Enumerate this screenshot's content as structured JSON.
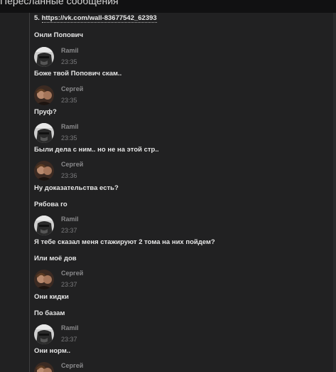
{
  "window": {
    "title": "Пересланные сообщения"
  },
  "messages": {
    "link_line": {
      "prefix": "5. ",
      "url": "https://vk.com/wall-83677542_62393"
    },
    "t1": "Онли Попович",
    "t2": "Боже твой Попович скам..",
    "t3": "Пруф?",
    "t4": "Были дела с ним.. но не на этой стр..",
    "t5": "Ну доказательства есть?",
    "t6": "Рябова го",
    "t7": "Я тебе сказал меня стажируют 2 тома на них пойдем?",
    "t8": "Или моё дов",
    "t9": "Они кидки",
    "t10": "По базам",
    "t11": "Они норм.."
  },
  "headers": [
    {
      "author": "Ramil",
      "time": "23:35",
      "avatar": "ramil-avatar"
    },
    {
      "author": "Сергей",
      "time": "23:35",
      "avatar": "sergey-avatar"
    },
    {
      "author": "Ramil",
      "time": "23:35",
      "avatar": "ramil-avatar"
    },
    {
      "author": "Сергей",
      "time": "23:36",
      "avatar": "sergey-avatar"
    },
    {
      "author": "Ramil",
      "time": "23:37",
      "avatar": "ramil-avatar"
    },
    {
      "author": "Сергей",
      "time": "23:37",
      "avatar": "sergey-avatar"
    },
    {
      "author": "Ramil",
      "time": "23:37",
      "avatar": "ramil-avatar"
    },
    {
      "author": "Сергей",
      "time": "",
      "avatar": "sergey-avatar"
    }
  ],
  "colors": {
    "background": "#212122",
    "titlebar": "#111112",
    "text": "#e6e6e6",
    "meta": "#8a8a8c"
  }
}
